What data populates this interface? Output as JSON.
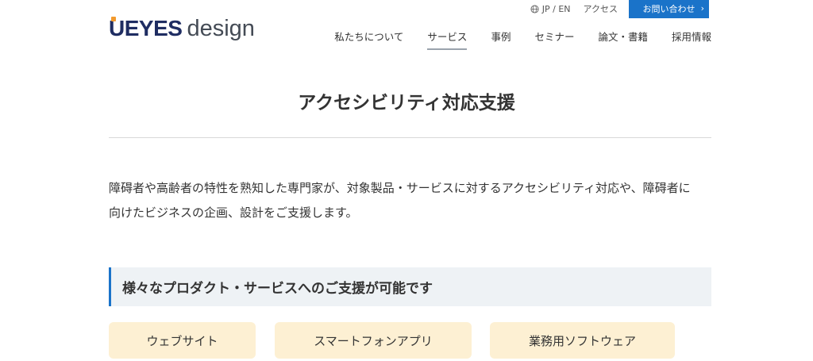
{
  "header": {
    "logo_mark": "U'EYES",
    "logo_word": "design",
    "lang_label": "JP / EN",
    "access_label": "アクセス",
    "contact_label": "お問い合わせ",
    "nav": [
      {
        "label": "私たちについて",
        "active": false
      },
      {
        "label": "サービス",
        "active": true
      },
      {
        "label": "事例",
        "active": false
      },
      {
        "label": "セミナー",
        "active": false
      },
      {
        "label": "論文・書籍",
        "active": false
      },
      {
        "label": "採用情報",
        "active": false
      }
    ]
  },
  "main": {
    "title": "アクセシビリティ対応支援",
    "intro_line1": "障碍者や高齢者の特性を熟知した専門家が、対象製品・サービスに対するアクセシビリティ対応や、障碍者に",
    "intro_line2": "向けたビジネスの企画、設計をご支援します。",
    "section_heading": "様々なプロダクト・サービスへのご支援が可能です",
    "tags": [
      "ウェブサイト",
      "スマートフォンアプリ",
      "業務用ソフトウェア"
    ]
  },
  "colors": {
    "accent": "#1a73c9",
    "logo_navy": "#1f2d62",
    "logo_orange": "#f29a2e",
    "tag_bg": "#fdf0d3",
    "section_bg": "#eef2f5"
  },
  "icons": {
    "globe": "globe-icon",
    "chevron": "chevron-right-icon"
  }
}
